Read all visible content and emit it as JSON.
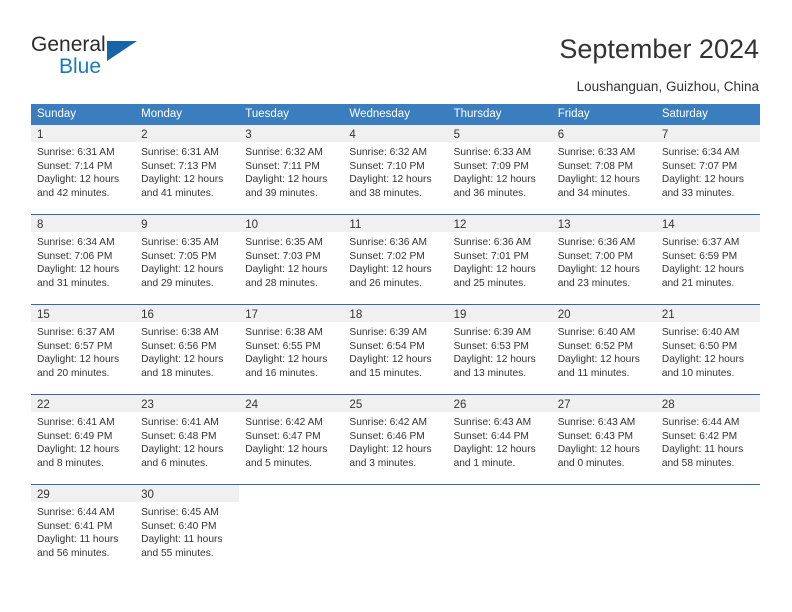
{
  "brand": {
    "name_part1": "General",
    "name_part2": "Blue",
    "logo_icon": "triangle-logo-icon"
  },
  "header": {
    "title": "September 2024",
    "location": "Loushanguan, Guizhou, China"
  },
  "calendar": {
    "accent_color": "#3a7ebf",
    "separator_color": "#2e6da4",
    "daynum_band_color": "#f0f0f0",
    "weekday_headers": [
      "Sunday",
      "Monday",
      "Tuesday",
      "Wednesday",
      "Thursday",
      "Friday",
      "Saturday"
    ],
    "weeks": [
      [
        {
          "day": "1",
          "sunrise": "Sunrise: 6:31 AM",
          "sunset": "Sunset: 7:14 PM",
          "daylight1": "Daylight: 12 hours",
          "daylight2": "and 42 minutes."
        },
        {
          "day": "2",
          "sunrise": "Sunrise: 6:31 AM",
          "sunset": "Sunset: 7:13 PM",
          "daylight1": "Daylight: 12 hours",
          "daylight2": "and 41 minutes."
        },
        {
          "day": "3",
          "sunrise": "Sunrise: 6:32 AM",
          "sunset": "Sunset: 7:11 PM",
          "daylight1": "Daylight: 12 hours",
          "daylight2": "and 39 minutes."
        },
        {
          "day": "4",
          "sunrise": "Sunrise: 6:32 AM",
          "sunset": "Sunset: 7:10 PM",
          "daylight1": "Daylight: 12 hours",
          "daylight2": "and 38 minutes."
        },
        {
          "day": "5",
          "sunrise": "Sunrise: 6:33 AM",
          "sunset": "Sunset: 7:09 PM",
          "daylight1": "Daylight: 12 hours",
          "daylight2": "and 36 minutes."
        },
        {
          "day": "6",
          "sunrise": "Sunrise: 6:33 AM",
          "sunset": "Sunset: 7:08 PM",
          "daylight1": "Daylight: 12 hours",
          "daylight2": "and 34 minutes."
        },
        {
          "day": "7",
          "sunrise": "Sunrise: 6:34 AM",
          "sunset": "Sunset: 7:07 PM",
          "daylight1": "Daylight: 12 hours",
          "daylight2": "and 33 minutes."
        }
      ],
      [
        {
          "day": "8",
          "sunrise": "Sunrise: 6:34 AM",
          "sunset": "Sunset: 7:06 PM",
          "daylight1": "Daylight: 12 hours",
          "daylight2": "and 31 minutes."
        },
        {
          "day": "9",
          "sunrise": "Sunrise: 6:35 AM",
          "sunset": "Sunset: 7:05 PM",
          "daylight1": "Daylight: 12 hours",
          "daylight2": "and 29 minutes."
        },
        {
          "day": "10",
          "sunrise": "Sunrise: 6:35 AM",
          "sunset": "Sunset: 7:03 PM",
          "daylight1": "Daylight: 12 hours",
          "daylight2": "and 28 minutes."
        },
        {
          "day": "11",
          "sunrise": "Sunrise: 6:36 AM",
          "sunset": "Sunset: 7:02 PM",
          "daylight1": "Daylight: 12 hours",
          "daylight2": "and 26 minutes."
        },
        {
          "day": "12",
          "sunrise": "Sunrise: 6:36 AM",
          "sunset": "Sunset: 7:01 PM",
          "daylight1": "Daylight: 12 hours",
          "daylight2": "and 25 minutes."
        },
        {
          "day": "13",
          "sunrise": "Sunrise: 6:36 AM",
          "sunset": "Sunset: 7:00 PM",
          "daylight1": "Daylight: 12 hours",
          "daylight2": "and 23 minutes."
        },
        {
          "day": "14",
          "sunrise": "Sunrise: 6:37 AM",
          "sunset": "Sunset: 6:59 PM",
          "daylight1": "Daylight: 12 hours",
          "daylight2": "and 21 minutes."
        }
      ],
      [
        {
          "day": "15",
          "sunrise": "Sunrise: 6:37 AM",
          "sunset": "Sunset: 6:57 PM",
          "daylight1": "Daylight: 12 hours",
          "daylight2": "and 20 minutes."
        },
        {
          "day": "16",
          "sunrise": "Sunrise: 6:38 AM",
          "sunset": "Sunset: 6:56 PM",
          "daylight1": "Daylight: 12 hours",
          "daylight2": "and 18 minutes."
        },
        {
          "day": "17",
          "sunrise": "Sunrise: 6:38 AM",
          "sunset": "Sunset: 6:55 PM",
          "daylight1": "Daylight: 12 hours",
          "daylight2": "and 16 minutes."
        },
        {
          "day": "18",
          "sunrise": "Sunrise: 6:39 AM",
          "sunset": "Sunset: 6:54 PM",
          "daylight1": "Daylight: 12 hours",
          "daylight2": "and 15 minutes."
        },
        {
          "day": "19",
          "sunrise": "Sunrise: 6:39 AM",
          "sunset": "Sunset: 6:53 PM",
          "daylight1": "Daylight: 12 hours",
          "daylight2": "and 13 minutes."
        },
        {
          "day": "20",
          "sunrise": "Sunrise: 6:40 AM",
          "sunset": "Sunset: 6:52 PM",
          "daylight1": "Daylight: 12 hours",
          "daylight2": "and 11 minutes."
        },
        {
          "day": "21",
          "sunrise": "Sunrise: 6:40 AM",
          "sunset": "Sunset: 6:50 PM",
          "daylight1": "Daylight: 12 hours",
          "daylight2": "and 10 minutes."
        }
      ],
      [
        {
          "day": "22",
          "sunrise": "Sunrise: 6:41 AM",
          "sunset": "Sunset: 6:49 PM",
          "daylight1": "Daylight: 12 hours",
          "daylight2": "and 8 minutes."
        },
        {
          "day": "23",
          "sunrise": "Sunrise: 6:41 AM",
          "sunset": "Sunset: 6:48 PM",
          "daylight1": "Daylight: 12 hours",
          "daylight2": "and 6 minutes."
        },
        {
          "day": "24",
          "sunrise": "Sunrise: 6:42 AM",
          "sunset": "Sunset: 6:47 PM",
          "daylight1": "Daylight: 12 hours",
          "daylight2": "and 5 minutes."
        },
        {
          "day": "25",
          "sunrise": "Sunrise: 6:42 AM",
          "sunset": "Sunset: 6:46 PM",
          "daylight1": "Daylight: 12 hours",
          "daylight2": "and 3 minutes."
        },
        {
          "day": "26",
          "sunrise": "Sunrise: 6:43 AM",
          "sunset": "Sunset: 6:44 PM",
          "daylight1": "Daylight: 12 hours",
          "daylight2": "and 1 minute."
        },
        {
          "day": "27",
          "sunrise": "Sunrise: 6:43 AM",
          "sunset": "Sunset: 6:43 PM",
          "daylight1": "Daylight: 12 hours",
          "daylight2": "and 0 minutes."
        },
        {
          "day": "28",
          "sunrise": "Sunrise: 6:44 AM",
          "sunset": "Sunset: 6:42 PM",
          "daylight1": "Daylight: 11 hours",
          "daylight2": "and 58 minutes."
        }
      ],
      [
        {
          "day": "29",
          "sunrise": "Sunrise: 6:44 AM",
          "sunset": "Sunset: 6:41 PM",
          "daylight1": "Daylight: 11 hours",
          "daylight2": "and 56 minutes."
        },
        {
          "day": "30",
          "sunrise": "Sunrise: 6:45 AM",
          "sunset": "Sunset: 6:40 PM",
          "daylight1": "Daylight: 11 hours",
          "daylight2": "and 55 minutes."
        },
        {
          "day": "",
          "sunrise": "",
          "sunset": "",
          "daylight1": "",
          "daylight2": ""
        },
        {
          "day": "",
          "sunrise": "",
          "sunset": "",
          "daylight1": "",
          "daylight2": ""
        },
        {
          "day": "",
          "sunrise": "",
          "sunset": "",
          "daylight1": "",
          "daylight2": ""
        },
        {
          "day": "",
          "sunrise": "",
          "sunset": "",
          "daylight1": "",
          "daylight2": ""
        },
        {
          "day": "",
          "sunrise": "",
          "sunset": "",
          "daylight1": "",
          "daylight2": ""
        }
      ]
    ]
  }
}
